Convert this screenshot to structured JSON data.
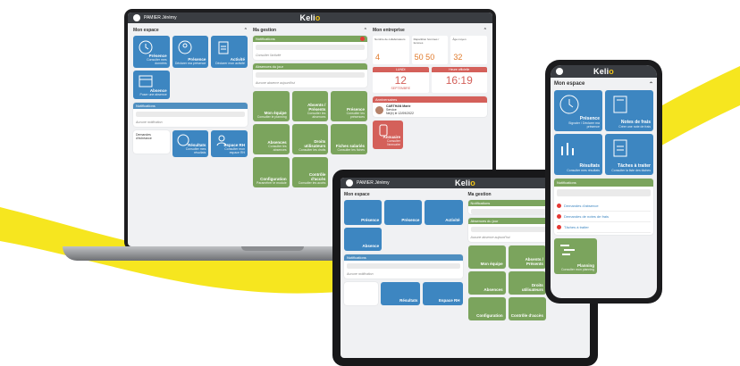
{
  "header": {
    "user": "PAMIER Jérémy",
    "brand_main": "Keli",
    "brand_accent": "o"
  },
  "col1": {
    "title": "Mon espace",
    "tiles": [
      {
        "title": "Présence",
        "sub": "Consulter mes données"
      },
      {
        "title": "Présence",
        "sub": "Déclarer ma présence"
      },
      {
        "title": "Activité",
        "sub": "Déclarer mon activité"
      },
      {
        "title": "Absence",
        "sub": "Poser une absence"
      }
    ],
    "notif_title": "Notifications",
    "notif_empty": "Aucune notification",
    "notif_entry_title": "Demandes d'échéance",
    "tiles2": [
      {
        "title": "Résultats",
        "sub": "Consulter mes résultats"
      },
      {
        "title": "Espace RH",
        "sub": "Consulter mon espace RH"
      }
    ]
  },
  "col2": {
    "title": "Ma gestion",
    "notif_head": "Notifications",
    "notif_entry": "Consulter l'activité",
    "abs_head": "Absences du jour",
    "abs_empty": "Aucune absence aujourd'hui",
    "tiles": [
      {
        "title": "Mon équipe",
        "sub": "Consulter le planning"
      },
      {
        "title": "Absents / Présents",
        "sub": "Consulter les absences"
      },
      {
        "title": "Présence",
        "sub": "Consulter les présences"
      },
      {
        "title": "Absences",
        "sub": "Consulter les absences"
      },
      {
        "title": "Droits utilisateurs",
        "sub": "Consulter les droits"
      },
      {
        "title": "Fiches salariés",
        "sub": "Consulter les fiches"
      },
      {
        "title": "Configuration",
        "sub": "Paramétrer le module"
      },
      {
        "title": "Contrôle d'accès",
        "sub": "Consulter les accès"
      }
    ]
  },
  "col3": {
    "title": "Mon entreprise",
    "kpis": [
      {
        "label": "Nombre de collaborateurs",
        "value": "4"
      },
      {
        "label": "Répartition hommes / femmes",
        "value": "50  50"
      },
      {
        "label": "Âge moyen",
        "value": "32"
      }
    ],
    "date_head": "LUNDI",
    "date_day": "12",
    "date_month": "SEPTEMBRE",
    "time_head": "Heure officielle",
    "time": "16:19",
    "birthday_head": "Anniversaires",
    "birthday_name": "CARTHAN Marie",
    "birthday_sub1": "Service",
    "birthday_sub2": "Né(e) le 12/09/2022",
    "tile": {
      "title": "Annuaire",
      "sub": "Consulter l'annuaire"
    }
  },
  "phone": {
    "title": "Mon espace",
    "tiles": [
      {
        "title": "Présence",
        "sub": "Signaler / Déclarer ma présence"
      },
      {
        "title": "Notes de frais",
        "sub": "Créer une note de frais"
      },
      {
        "title": "Résultats",
        "sub": "Consulter mes résultats"
      },
      {
        "title": "Tâches à traiter",
        "sub": "Consulter la liste des tâches"
      }
    ],
    "notif_title": "Notifications",
    "items": [
      "Demandes d'absence",
      "Demandes de notes de frais",
      "Tâches à traiter"
    ],
    "planning": {
      "title": "Planning",
      "sub": "Consulter mon planning"
    }
  },
  "tablet": {
    "col1": "Mon espace",
    "col2": "Ma gestion"
  },
  "colors": {
    "yellow": "#f6e61f",
    "blue": "#3d86c1",
    "green": "#7ba45d",
    "red": "#d4605a"
  }
}
